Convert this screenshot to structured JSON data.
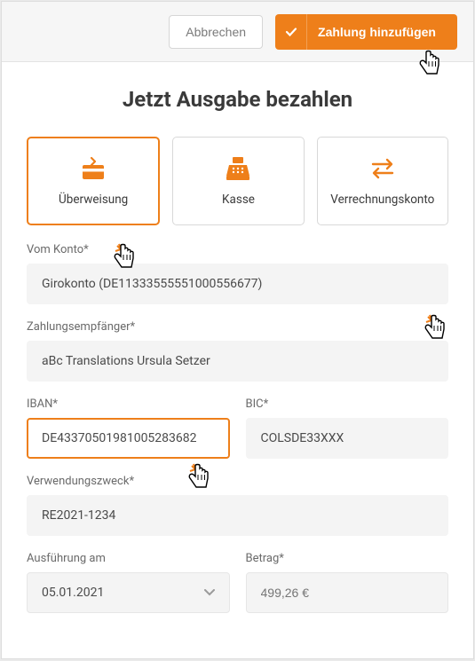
{
  "topbar": {
    "cancel": "Abbrechen",
    "submit": "Zahlung hinzufügen"
  },
  "title": "Jetzt Ausgabe bezahlen",
  "methods": {
    "transfer": "Überweisung",
    "cash": "Kasse",
    "clearing": "Verrechnungskonto"
  },
  "fields": {
    "from_account_label": "Vom Konto*",
    "from_account_value": "Girokonto (DE11333555551000556677)",
    "payee_label": "Zahlungsempfänger*",
    "payee_value": "aBc Translations Ursula Setzer",
    "iban_label": "IBAN*",
    "iban_value": "DE43370501981005283682",
    "bic_label": "BIC*",
    "bic_value": "COLSDE33XXX",
    "purpose_label": "Verwendungszweck*",
    "purpose_value": "RE2021-1234",
    "exec_label": "Ausführung am",
    "exec_value": "05.01.2021",
    "amount_label": "Betrag*",
    "amount_placeholder": "499,26 €"
  }
}
